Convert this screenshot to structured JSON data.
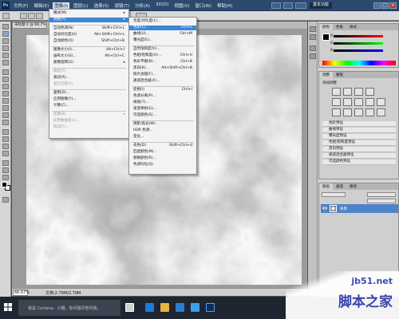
{
  "app": {
    "logo": "Ps",
    "menus": [
      "文件(F)",
      "编辑(E)",
      "图像(I)",
      "图层(L)",
      "选择(S)",
      "滤镜(T)",
      "分析(A)",
      "3D(D)",
      "视图(V)",
      "窗口(W)",
      "帮助(H)"
    ],
    "active_menu": "图像(I)",
    "workspace": "基本功能",
    "window_controls": [
      "-",
      "□",
      "×"
    ]
  },
  "document": {
    "tab_label": "未标题-1 @ 66.7%",
    "zoom": "66.67%",
    "info": "文档:2.79M/2.79M"
  },
  "image_menu": {
    "items": [
      {
        "label": "模式(M)",
        "shortcut": "",
        "submenu": true,
        "disabled": false
      },
      {
        "label": "调整(A)",
        "shortcut": "",
        "submenu": true,
        "disabled": false,
        "highlight": true
      },
      {
        "label": "自动色调(N)",
        "shortcut": "Shift+Ctrl+L",
        "disabled": false
      },
      {
        "label": "自动对比度(U)",
        "shortcut": "Alt+Shift+Ctrl+L",
        "disabled": false
      },
      {
        "label": "自动颜色(O)",
        "shortcut": "Shift+Ctrl+B",
        "disabled": false
      },
      {
        "label": "图像大小(I)...",
        "shortcut": "Alt+Ctrl+I",
        "disabled": false
      },
      {
        "label": "画布大小(S)...",
        "shortcut": "Alt+Ctrl+C",
        "disabled": false
      },
      {
        "label": "图像旋转(G)",
        "shortcut": "",
        "submenu": true,
        "disabled": false
      },
      {
        "label": "裁剪(P)",
        "shortcut": "",
        "disabled": true
      },
      {
        "label": "裁切(R)...",
        "shortcut": "",
        "disabled": false
      },
      {
        "label": "显示全部(V)",
        "shortcut": "",
        "disabled": true
      },
      {
        "label": "复制(D)...",
        "shortcut": "",
        "disabled": false
      },
      {
        "label": "应用图像(Y)...",
        "shortcut": "",
        "disabled": false
      },
      {
        "label": "计算(C)...",
        "shortcut": "",
        "disabled": false
      },
      {
        "label": "变量(B)",
        "shortcut": "",
        "submenu": true,
        "disabled": true
      },
      {
        "label": "应用数据组(L)...",
        "shortcut": "",
        "disabled": true
      },
      {
        "label": "陷印(T)...",
        "shortcut": "",
        "disabled": true
      }
    ]
  },
  "adjust_menu": {
    "items": [
      {
        "label": "亮度/对比度(C)...",
        "shortcut": ""
      },
      {
        "label": "色阶(L)...",
        "shortcut": "Ctrl+L",
        "highlight": true
      },
      {
        "label": "曲线(U)...",
        "shortcut": "Ctrl+M"
      },
      {
        "label": "曝光度(E)...",
        "shortcut": ""
      },
      {
        "label": "自然饱和度(V)...",
        "shortcut": ""
      },
      {
        "label": "色相/饱和度(H)...",
        "shortcut": "Ctrl+U"
      },
      {
        "label": "色彩平衡(B)...",
        "shortcut": "Ctrl+B"
      },
      {
        "label": "黑白(K)...",
        "shortcut": "Alt+Shift+Ctrl+B"
      },
      {
        "label": "照片滤镜(F)...",
        "shortcut": ""
      },
      {
        "label": "通道混合器(X)...",
        "shortcut": ""
      },
      {
        "label": "反相(I)",
        "shortcut": "Ctrl+I"
      },
      {
        "label": "色调分离(P)...",
        "shortcut": ""
      },
      {
        "label": "阈值(T)...",
        "shortcut": ""
      },
      {
        "label": "渐变映射(G)...",
        "shortcut": ""
      },
      {
        "label": "可选颜色(S)...",
        "shortcut": ""
      },
      {
        "label": "阴影/高光(W)...",
        "shortcut": ""
      },
      {
        "label": "HDR 色调...",
        "shortcut": ""
      },
      {
        "label": "变化...",
        "shortcut": ""
      },
      {
        "label": "去色(D)",
        "shortcut": "Shift+Ctrl+U"
      },
      {
        "label": "匹配颜色(M)...",
        "shortcut": ""
      },
      {
        "label": "替换颜色(R)...",
        "shortcut": ""
      },
      {
        "label": "色调均化(Q)",
        "shortcut": ""
      }
    ]
  },
  "color_panel": {
    "tabs": [
      "颜色",
      "色板",
      "样式"
    ],
    "channels": [
      "R",
      "G",
      "B"
    ]
  },
  "adjustments_panel": {
    "tabs": [
      "调整",
      "蒙版"
    ],
    "heading": "添加调整",
    "presets": [
      "色阶预设",
      "曲线预设",
      "曝光度预设",
      "色相/饱和度预设",
      "黑白预设",
      "通道混合器预设",
      "可选颜色预设"
    ]
  },
  "layers_panel": {
    "tabs": [
      "图层",
      "通道",
      "路径"
    ],
    "layer_name": "背景"
  },
  "taskbar": {
    "search_text": "我是 Cortana，小娜。有问题尽管问我。"
  },
  "watermark": {
    "site": "jb51.net",
    "name": "脚本之家"
  }
}
